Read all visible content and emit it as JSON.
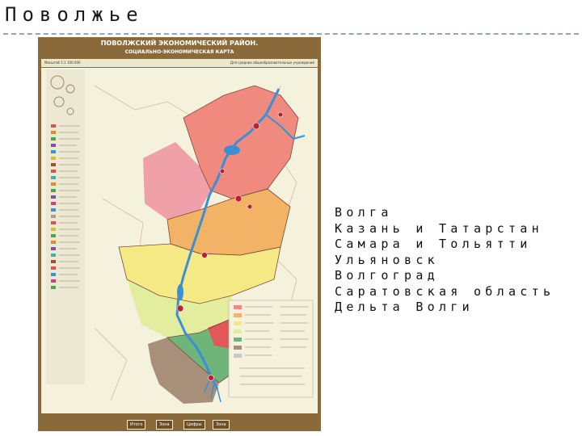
{
  "slide": {
    "title": "Поволжье",
    "places": [
      "Волга",
      "Казань и Татарстан",
      "Самара и Тольятти",
      "Ульяновск",
      "Волгоград",
      "Саратовская область",
      "Дельта Волги"
    ]
  },
  "map": {
    "title": "ПОВОЛЖСКИЙ ЭКОНОМИЧЕСКИЙ РАЙОН.",
    "subtitle": "СОЦИАЛЬНО-ЭКОНОМИЧЕСКАЯ КАРТА",
    "scale": "Масштаб 1:1 100 000",
    "audience": "Для средних общеобразовательных учреждений",
    "footer_buttons": [
      "Итого",
      "Зона",
      "Цифры",
      "Зона"
    ]
  },
  "colors": {
    "frame": "#8a6a3a",
    "paper": "#f4f1dc",
    "volga": "#3a8fd6",
    "tatarstan": "#f08a7e",
    "ulyanovsk_samara": "#f2b366",
    "saratov": "#f5e985",
    "volgograd": "#e3ed9e",
    "astrakhan_green": "#6fb57a",
    "kalmykia_brown": "#a88f7a",
    "accent_dashes": "#8fa3c4"
  }
}
